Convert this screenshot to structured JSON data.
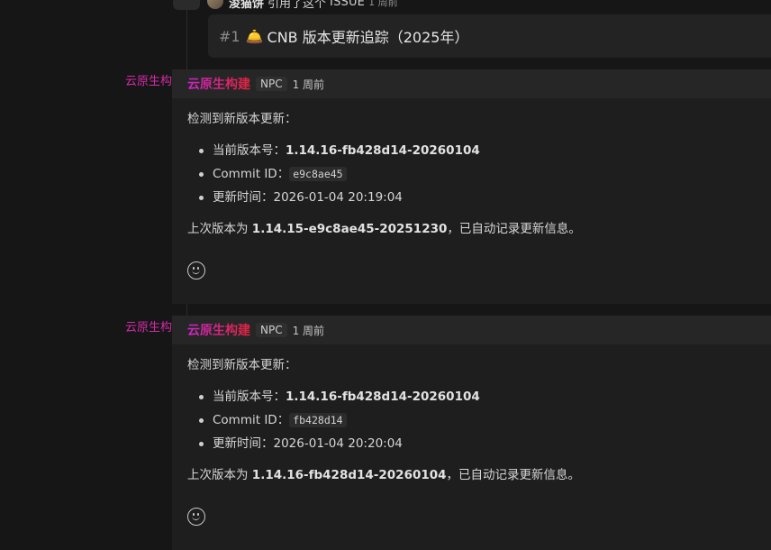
{
  "reference": {
    "icon": "#",
    "user": "浚猫饼",
    "action": "引用了这个",
    "type": "ISSUE",
    "time": "1 周前"
  },
  "issue": {
    "number": "#1",
    "bell_icon": "🛎️",
    "title": "CNB 版本更新追踪（2025年）"
  },
  "comments": [
    {
      "side_label": "云原生构建",
      "author": "云原生构建",
      "badge": "NPC",
      "time": "1 周前",
      "intro": "检测到新版本更新：",
      "items": [
        {
          "label": "当前版本号：",
          "value": "1.14.16-fb428d14-20260104"
        },
        {
          "label": "Commit ID：",
          "value": "e9c8ae45"
        },
        {
          "label": "更新时间：",
          "value": "2026-01-04 20:19:04"
        }
      ],
      "summary_prefix": "上次版本为 ",
      "summary_version": "1.14.15-e9c8ae45-20251230",
      "summary_suffix": "，已自动记录更新信息。"
    },
    {
      "side_label": "云原生构建",
      "author": "云原生构建",
      "badge": "NPC",
      "time": "1 周前",
      "intro": "检测到新版本更新：",
      "items": [
        {
          "label": "当前版本号：",
          "value": "1.14.16-fb428d14-20260104"
        },
        {
          "label": "Commit ID：",
          "value": "fb428d14"
        },
        {
          "label": "更新时间：",
          "value": "2026-01-04 20:20:04"
        }
      ],
      "summary_prefix": "上次版本为 ",
      "summary_version": "1.14.16-fb428d14-20260104",
      "summary_suffix": "，已自动记录更新信息。"
    }
  ]
}
